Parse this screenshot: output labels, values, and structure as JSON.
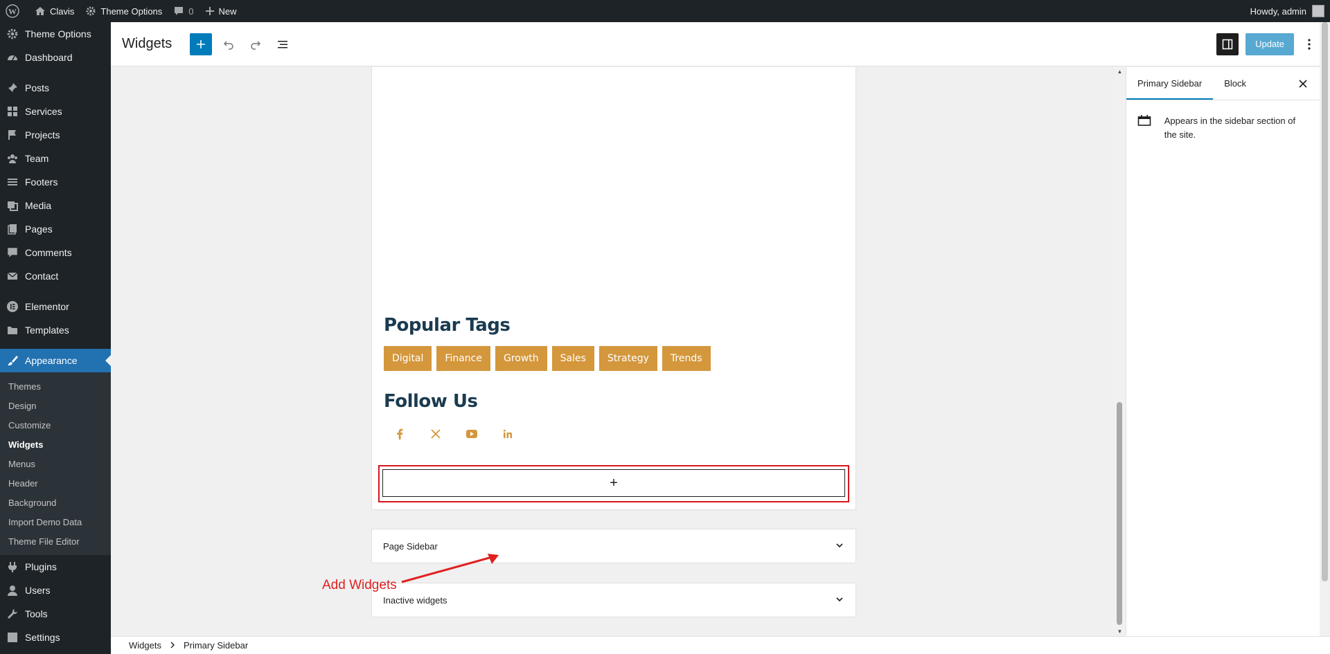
{
  "adminbar": {
    "site_name": "Clavis",
    "theme_options": "Theme Options",
    "comments_count": "0",
    "new_label": "New",
    "howdy": "Howdy, admin"
  },
  "menu": {
    "theme_options": "Theme Options",
    "dashboard": "Dashboard",
    "posts": "Posts",
    "services": "Services",
    "projects": "Projects",
    "team": "Team",
    "footers": "Footers",
    "media": "Media",
    "pages": "Pages",
    "comments": "Comments",
    "contact": "Contact",
    "elementor": "Elementor",
    "templates": "Templates",
    "appearance": "Appearance",
    "sub": [
      "Themes",
      "Design",
      "Customize",
      "Widgets",
      "Menus",
      "Header",
      "Background",
      "Import Demo Data",
      "Theme File Editor"
    ],
    "plugins": "Plugins",
    "users": "Users",
    "tools": "Tools",
    "settings": "Settings"
  },
  "header": {
    "title": "Widgets",
    "update_label": "Update"
  },
  "widget_area": {
    "popular_tags_title": "Popular Tags",
    "tags": [
      "Digital",
      "Finance",
      "Growth",
      "Sales",
      "Strategy",
      "Trends"
    ],
    "follow_title": "Follow Us",
    "appender_symbol": "+"
  },
  "panels": {
    "page_sidebar": "Page Sidebar",
    "inactive_widgets": "Inactive widgets"
  },
  "annotation": {
    "label": "Add Widgets",
    "color": "#e02020"
  },
  "settings": {
    "tab_primary": "Primary Sidebar",
    "tab_block": "Block",
    "description": "Appears in the sidebar section of the site."
  },
  "breadcrumb": {
    "root": "Widgets",
    "current": "Primary Sidebar"
  },
  "colors": {
    "accent": "#007cba",
    "admin_dark": "#1d2327",
    "tag_bg": "#d4973c",
    "heading": "#1a3b50"
  }
}
